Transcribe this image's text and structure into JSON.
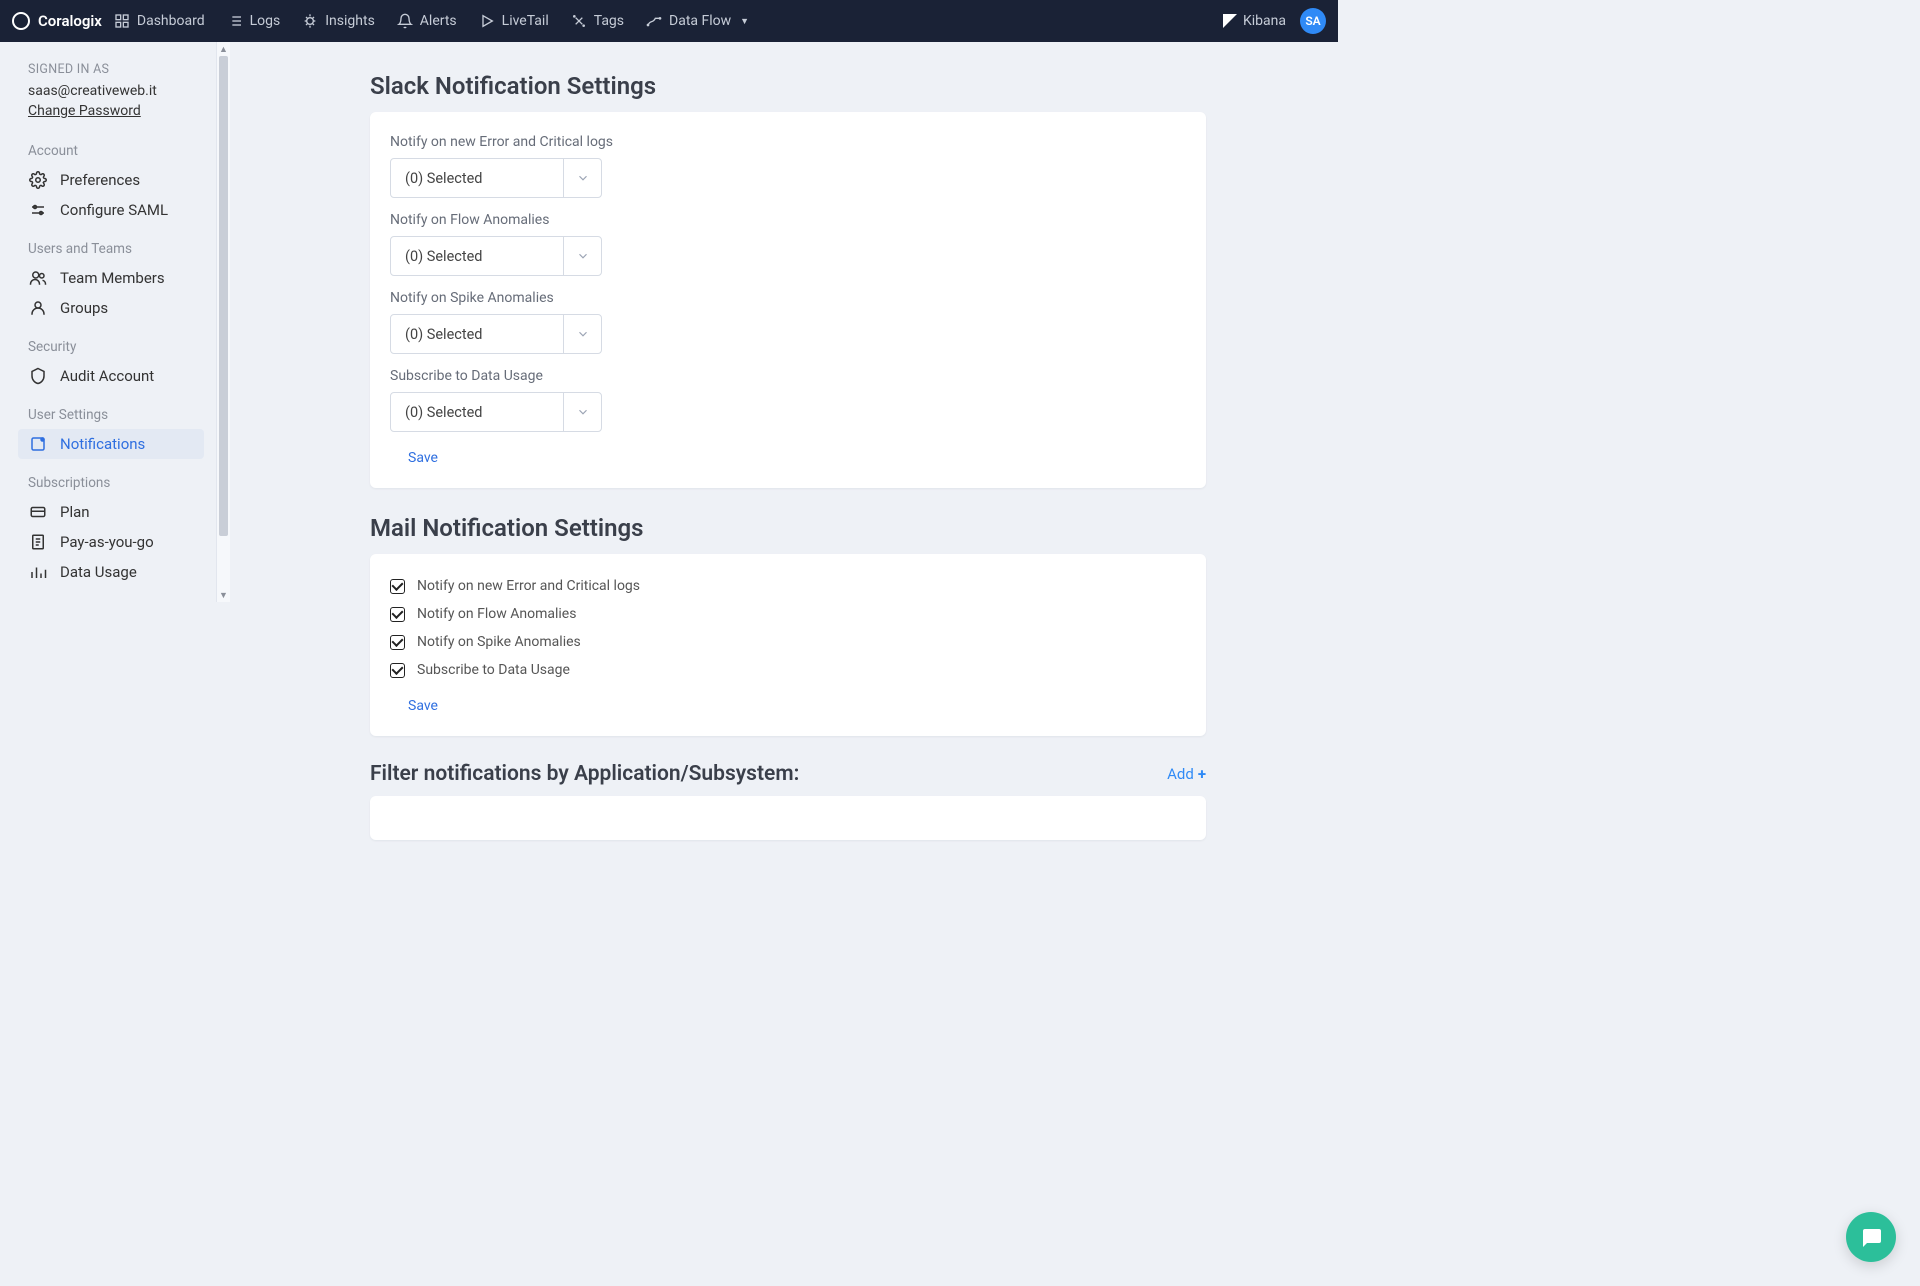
{
  "brand": "Coralogix",
  "nav": [
    {
      "label": "Dashboard"
    },
    {
      "label": "Logs"
    },
    {
      "label": "Insights"
    },
    {
      "label": "Alerts"
    },
    {
      "label": "LiveTail"
    },
    {
      "label": "Tags"
    },
    {
      "label": "Data Flow",
      "caret": true
    }
  ],
  "kibana_label": "Kibana",
  "avatar_initials": "SA",
  "sidebar": {
    "signed_label": "SIGNED IN AS",
    "signed_email": "saas@creativeweb.it",
    "change_password": "Change Password",
    "sections": [
      {
        "label": "Account",
        "items": [
          {
            "label": "Preferences",
            "name": "preferences"
          },
          {
            "label": "Configure SAML",
            "name": "configure-saml"
          }
        ]
      },
      {
        "label": "Users and Teams",
        "items": [
          {
            "label": "Team Members",
            "name": "team-members"
          },
          {
            "label": "Groups",
            "name": "groups"
          }
        ]
      },
      {
        "label": "Security",
        "items": [
          {
            "label": "Audit Account",
            "name": "audit-account"
          }
        ]
      },
      {
        "label": "User Settings",
        "items": [
          {
            "label": "Notifications",
            "name": "notifications",
            "active": true
          }
        ]
      },
      {
        "label": "Subscriptions",
        "items": [
          {
            "label": "Plan",
            "name": "plan"
          },
          {
            "label": "Pay-as-you-go",
            "name": "pay-as-you-go"
          },
          {
            "label": "Data Usage",
            "name": "data-usage"
          }
        ]
      }
    ]
  },
  "slack": {
    "title": "Slack Notification Settings",
    "fields": [
      {
        "label": "Notify on new Error and Critical logs",
        "value": "(0) Selected"
      },
      {
        "label": "Notify on Flow Anomalies",
        "value": "(0) Selected"
      },
      {
        "label": "Notify on Spike Anomalies",
        "value": "(0) Selected"
      },
      {
        "label": "Subscribe to Data Usage",
        "value": "(0) Selected"
      }
    ],
    "save": "Save"
  },
  "mail": {
    "title": "Mail Notification Settings",
    "checks": [
      {
        "label": "Notify on new Error and Critical logs",
        "checked": true
      },
      {
        "label": "Notify on Flow Anomalies",
        "checked": true
      },
      {
        "label": "Notify on Spike Anomalies",
        "checked": true
      },
      {
        "label": "Subscribe to Data Usage",
        "checked": true
      }
    ],
    "save": "Save"
  },
  "filter": {
    "title": "Filter notifications by Application/Subsystem:",
    "add_label": "Add"
  }
}
